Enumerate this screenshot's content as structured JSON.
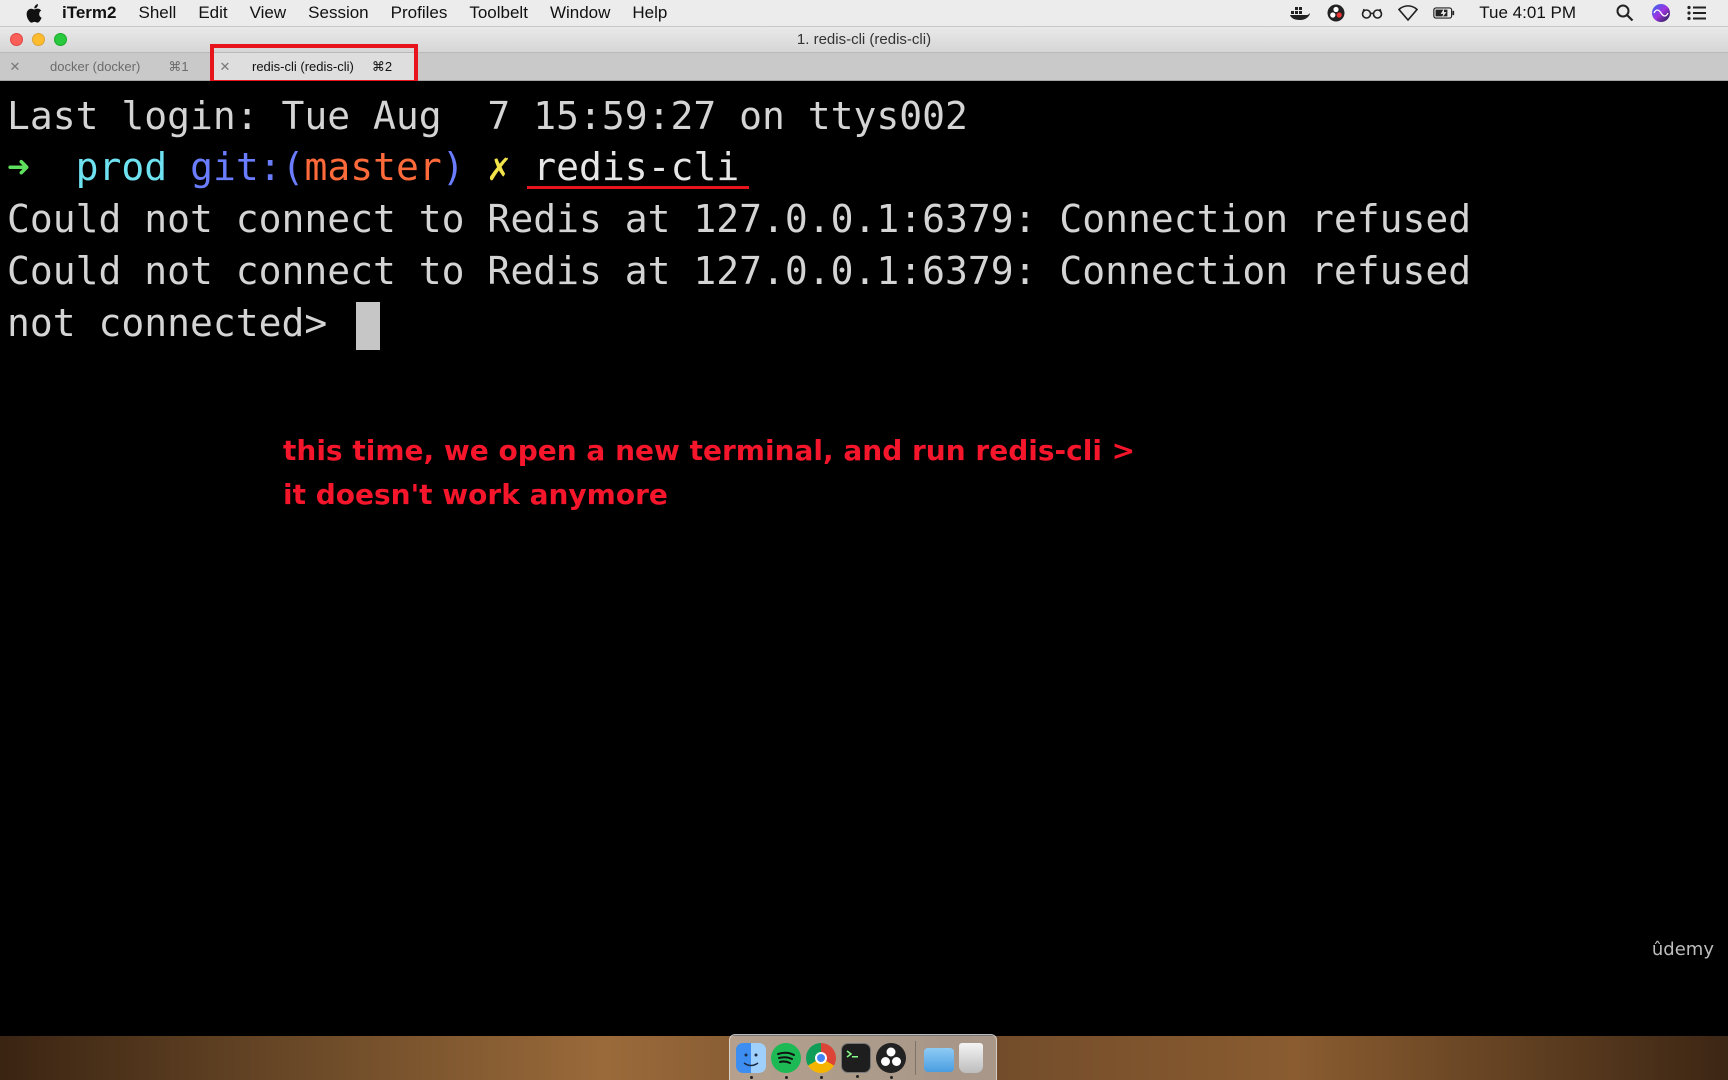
{
  "menubar": {
    "apple_icon": "apple-icon",
    "items": [
      "iTerm2",
      "Shell",
      "Edit",
      "View",
      "Session",
      "Profiles",
      "Toolbelt",
      "Window",
      "Help"
    ],
    "tray_icons": [
      "docker-icon",
      "obs-icon",
      "glasses-icon",
      "wifi-icon",
      "battery-icon"
    ],
    "clock": "Tue 4:01 PM",
    "right_icons": [
      "spotlight-icon",
      "siri-icon",
      "notification-center-icon"
    ]
  },
  "window": {
    "title": "1. redis-cli (redis-cli)"
  },
  "tabs": [
    {
      "label": "docker (docker)",
      "shortcut": "⌘1",
      "active": false
    },
    {
      "label": "redis-cli (redis-cli)",
      "shortcut": "⌘2",
      "active": true
    }
  ],
  "terminal": {
    "last_login": "Last login: Tue Aug  7 15:59:27 on ttys002",
    "prompt": {
      "arrow": "➜",
      "dir": "prod",
      "git_prefix": "git:(",
      "branch": "master",
      "git_suffix": ")",
      "dirty_mark": "✗",
      "command": "redis-cli"
    },
    "output": [
      "Could not connect to Redis at 127.0.0.1:6379: Connection refused",
      "Could not connect to Redis at 127.0.0.1:6379: Connection refused"
    ],
    "redis_prompt": "not connected> "
  },
  "annotation": "this time, we open a new terminal, and run redis-cli > it doesn't work anymore",
  "watermark": "ûdemy",
  "dock": {
    "apps": [
      "finder-icon",
      "spotify-icon",
      "chrome-icon",
      "terminal-icon",
      "obs-icon"
    ],
    "others": [
      "downloads-folder-icon",
      "trash-icon"
    ]
  },
  "colors": {
    "annotation": "#f5162b",
    "highlight": "#e8141b",
    "prompt_arrow": "#5fe05f",
    "prompt_dir": "#6ee2f0",
    "git": "#6a7dff",
    "branch": "#ff6a3b",
    "dirty": "#f2e34b"
  }
}
